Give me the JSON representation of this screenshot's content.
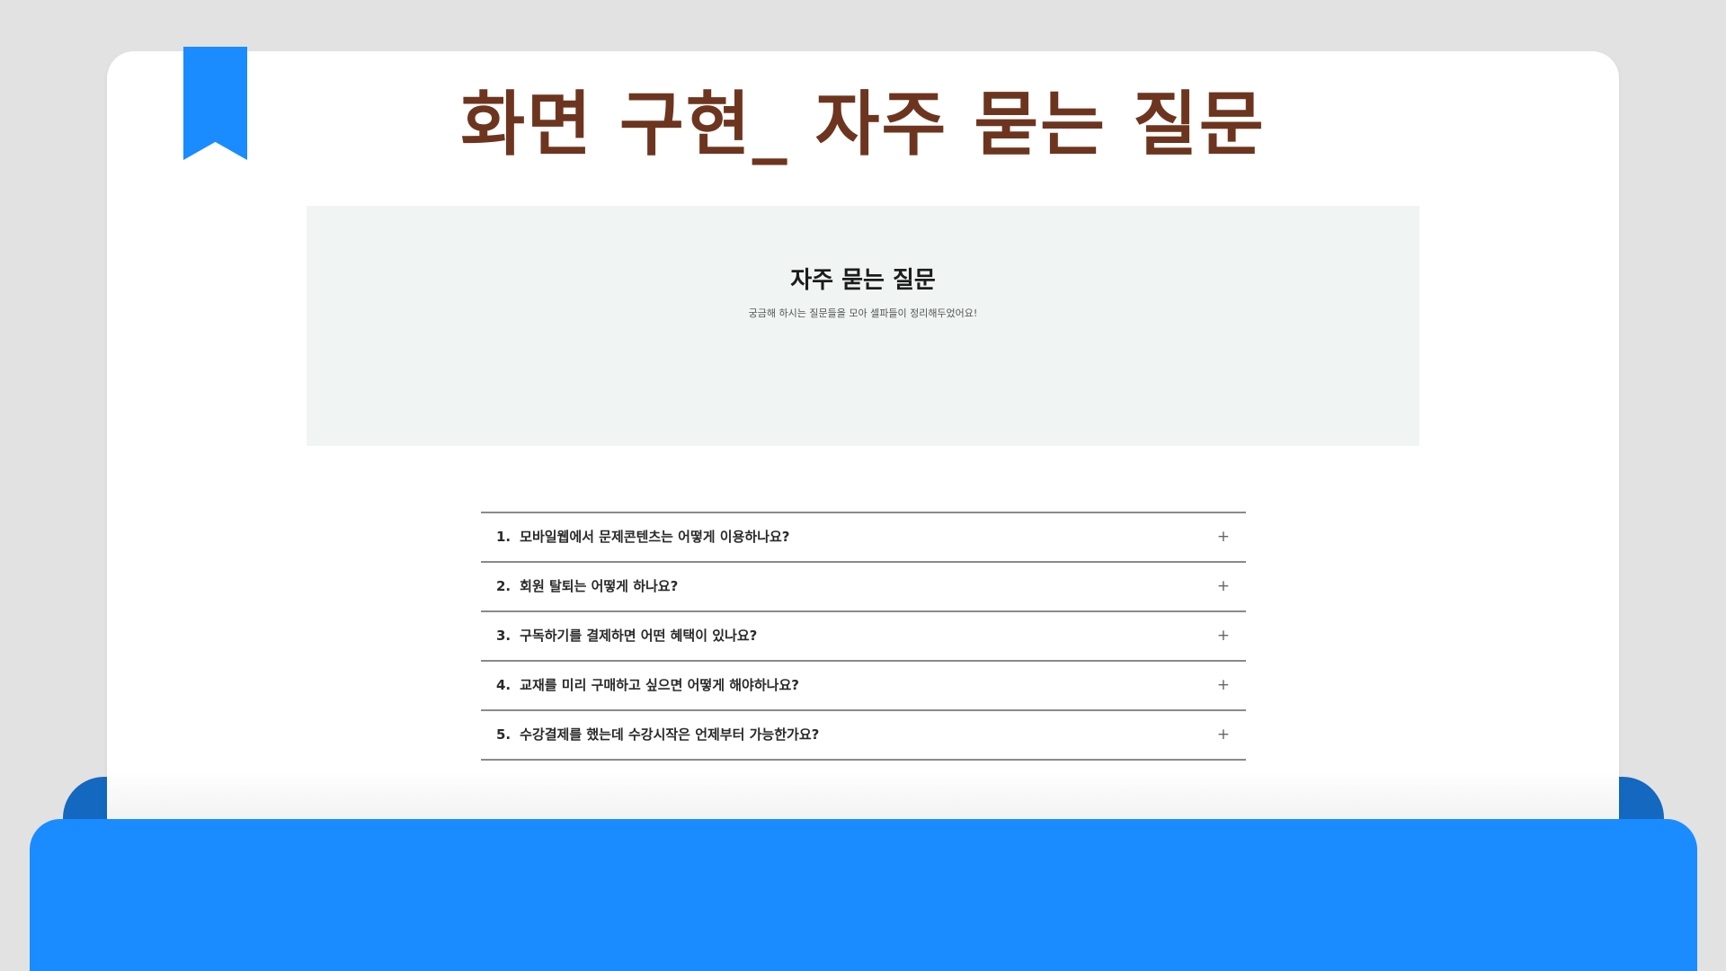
{
  "slide": {
    "title": "화면 구현_ 자주 묻는 질문"
  },
  "hero": {
    "title": "자주 묻는 질문",
    "subtitle": "궁금해 하시는 질문들을 모아 셀파들이 정리해두었어요!"
  },
  "faq": {
    "items": [
      {
        "num": "1.",
        "question": "모바일웹에서 문제콘텐츠는 어떻게 이용하나요?",
        "icon": "+"
      },
      {
        "num": "2.",
        "question": "회원 탈퇴는 어떻게 하나요?",
        "icon": "+"
      },
      {
        "num": "3.",
        "question": "구독하기를 결제하면 어떤 혜택이 있나요?",
        "icon": "+"
      },
      {
        "num": "4.",
        "question": "교재를 미리 구매하고 싶으면 어떻게 해야하나요?",
        "icon": "+"
      },
      {
        "num": "5.",
        "question": "수강결제를 했는데 수강시작은 언제부터 가능한가요?",
        "icon": "+"
      }
    ]
  },
  "colors": {
    "background": "#e2e2e2",
    "accent_blue": "#1a8cff",
    "dark_blue": "#1468bf",
    "title_brown": "#6d351f",
    "hero_bg": "#f0f5f4"
  },
  "icons": {
    "bookmark": "bookmark-icon",
    "expand": "plus-icon"
  }
}
